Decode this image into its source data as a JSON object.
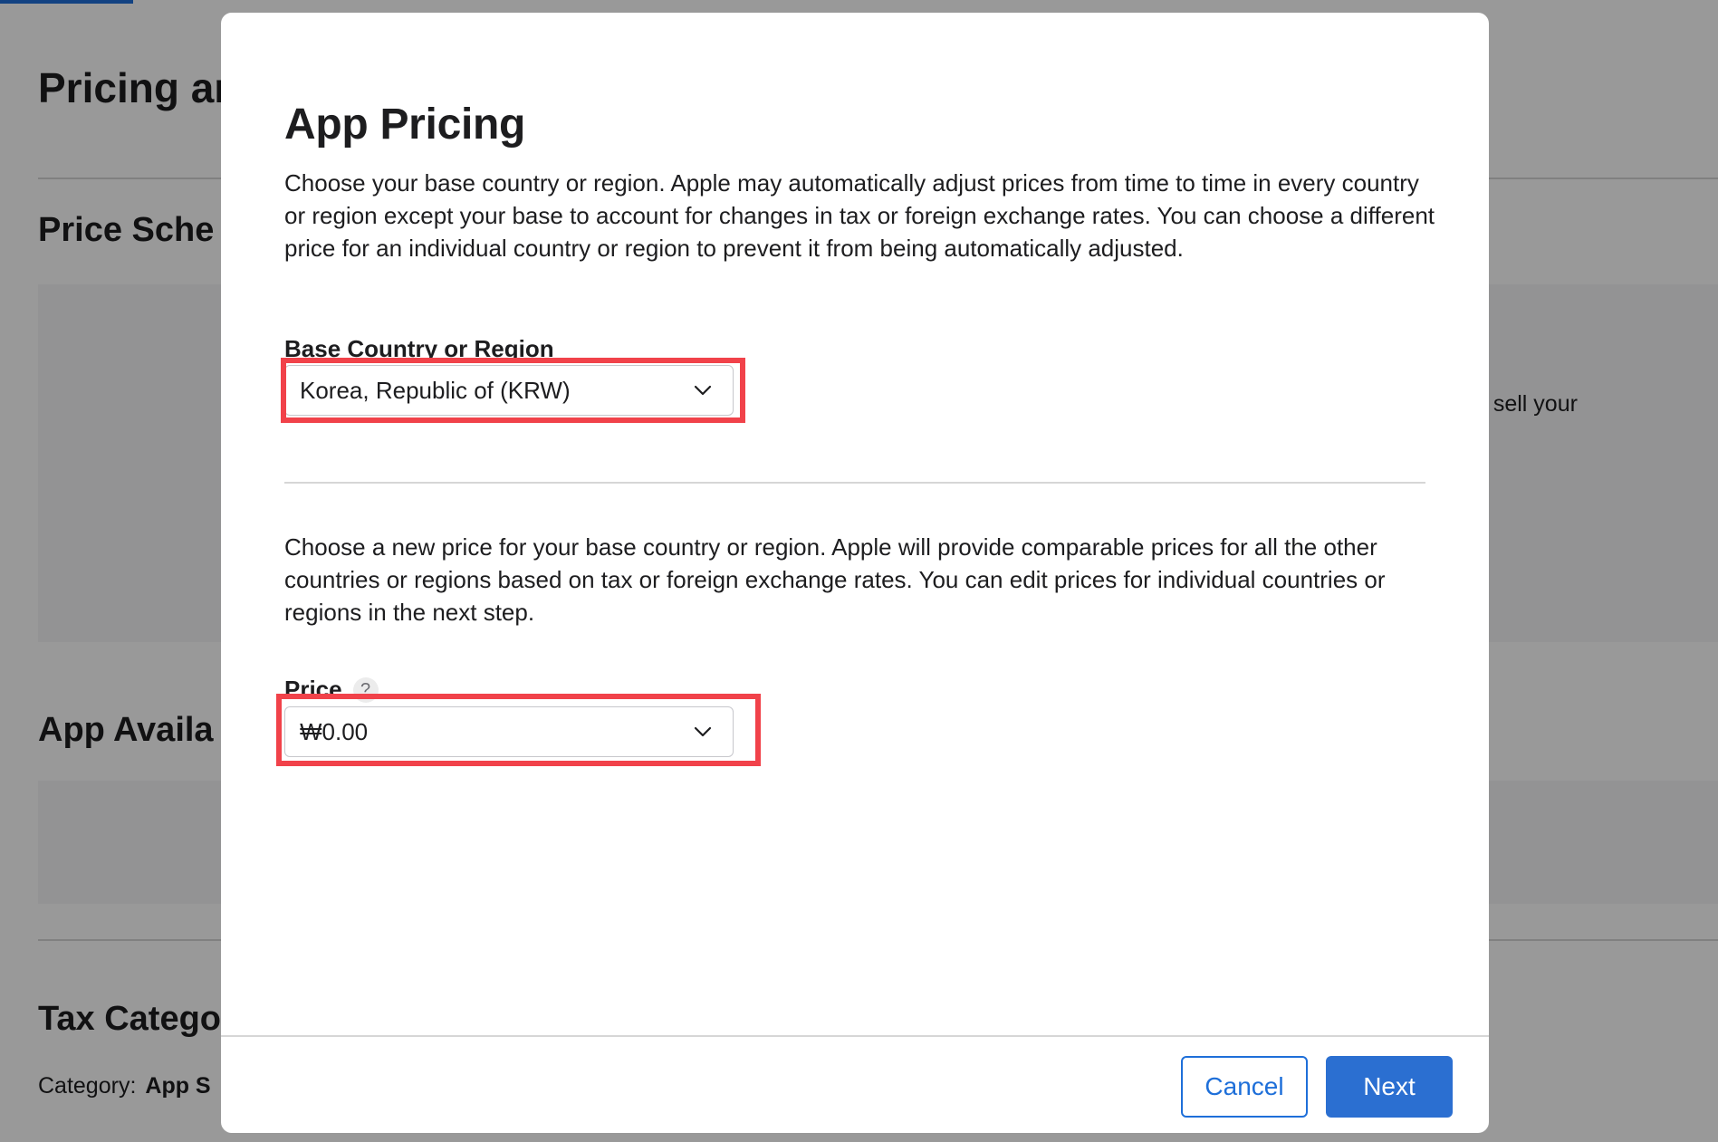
{
  "background": {
    "page_title": "Pricing ar",
    "sections": [
      "Price Sche",
      "App Availa",
      "Tax Catego"
    ],
    "side_text": "o sell your",
    "category_label": "Category:",
    "category_value": "App S"
  },
  "modal": {
    "title": "App Pricing",
    "base_description": "Choose your base country or region. Apple may automatically adjust prices from time to time in every country or region except your base to account for changes in tax or foreign exchange rates. You can choose a different price for an individual country or region to prevent it from being automatically adjusted.",
    "base_country": {
      "label": "Base Country or Region",
      "selected": "Korea, Republic of (KRW)"
    },
    "price_description": "Choose a new price for your base country or region. Apple will provide comparable prices for all the other countries or regions based on tax or foreign exchange rates. You can edit prices for individual countries or regions in the next step.",
    "price": {
      "label": "Price",
      "help_icon": "?",
      "selected": "₩0.00"
    },
    "buttons": {
      "cancel": "Cancel",
      "next": "Next"
    }
  },
  "colors": {
    "accent": "#1e6fd9",
    "primary_button": "#2b6fd1",
    "highlight": "#f1424a",
    "overlay": "rgba(0,0,0,0.4)"
  },
  "icons": {
    "dropdown": "chevron-down-icon",
    "help": "question-icon"
  }
}
